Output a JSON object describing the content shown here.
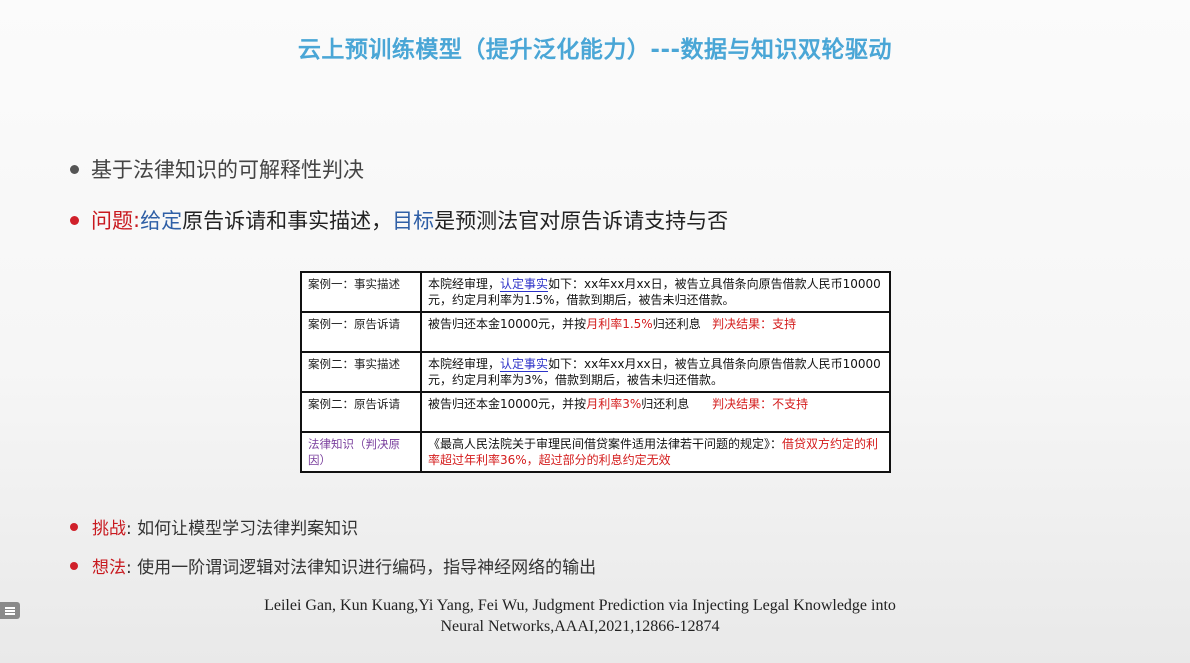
{
  "slide": {
    "title": "云上预训练模型（提升泛化能力）---数据与知识双轮驱动",
    "bullet1": "基于法律知识的可解释性判决",
    "bullet2": {
      "label": "问题",
      "colon": ": ",
      "given": "给定",
      "part1": " 原告诉请和事实描述，",
      "goal": "目标",
      "part2": "是预测法官对原告诉请支持与否"
    },
    "bullet3": {
      "label": "挑战",
      "text": ": 如何让模型学习法律判案知识"
    },
    "bullet4": {
      "label": "想法",
      "text": ": 使用一阶谓词逻辑对法律知识进行编码，指导神经网络的输出"
    },
    "citation_line1": "Leilei Gan, Kun Kuang,Yi Yang, Fei Wu,  Judgment Prediction via Injecting Legal Knowledge into",
    "citation_line2": "Neural Networks,AAAI,2021,12866-12874"
  },
  "table": {
    "row1": {
      "label": "案例一：事实描述",
      "pre": "本院经审理，",
      "hl": "认定事实",
      "post": "如下：xx年xx月xx日，被告立具借条向原告借款人民币10000元，约定月利率为1.5%，借款到期后，被告未归还借款。"
    },
    "row2": {
      "label": "案例一：原告诉请",
      "pre": "被告归还本金10000元，并按",
      "hl": "月利率1.5%",
      "post": "归还利息",
      "verdict": "判决结果：支持"
    },
    "row3": {
      "label": "案例二：事实描述",
      "pre": "本院经审理，",
      "hl": "认定事实",
      "post": "如下：xx年xx月xx日，被告立具借条向原告借款人民币10000元，约定月利率为3%，借款到期后，被告未归还借款。"
    },
    "row4": {
      "label": "案例二：原告诉请",
      "pre": "被告归还本金10000元，并按",
      "hl": "月利率3%",
      "post": "归还利息",
      "verdict": "判决结果：不支持"
    },
    "row5": {
      "label": "法律知识（判决原因）",
      "pre": "《最高人民法院关于审理民间借贷案件适用法律若干问题的规定》：",
      "hl": "借贷双方约定的利率超过年利率36%，超过部分的利息约定无效"
    }
  },
  "ui": {
    "side_button_icon": "menu-icon"
  }
}
